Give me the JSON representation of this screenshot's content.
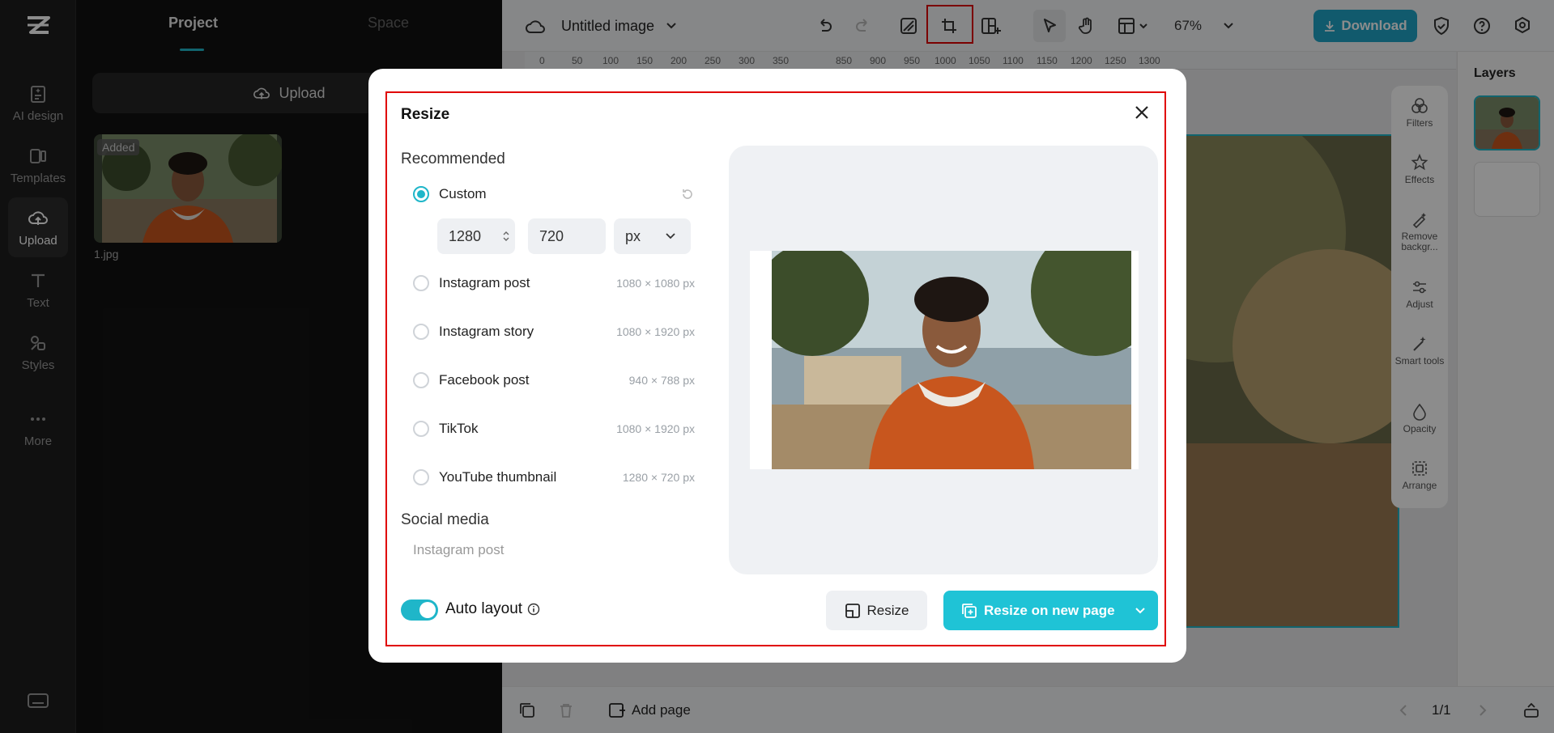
{
  "rail": {
    "items": [
      {
        "label": "AI design",
        "icon": "ai-design-icon"
      },
      {
        "label": "Templates",
        "icon": "templates-icon"
      },
      {
        "label": "Upload",
        "icon": "upload-cloud-icon",
        "active": true
      },
      {
        "label": "Text",
        "icon": "text-icon"
      },
      {
        "label": "Styles",
        "icon": "styles-icon"
      },
      {
        "label": "More",
        "icon": "more-icon"
      }
    ]
  },
  "panel": {
    "tabs": [
      "Project",
      "Space"
    ],
    "upload_label": "Upload",
    "asset": {
      "badge": "Added",
      "name": "1.jpg"
    }
  },
  "topbar": {
    "doc_title": "Untitled image",
    "zoom": "67%",
    "download_label": "Download"
  },
  "ruler": {
    "ticks_left": [
      "0",
      "50",
      "100",
      "150",
      "200",
      "250",
      "300",
      "350"
    ],
    "ticks_right": [
      "850",
      "900",
      "950",
      "1000",
      "1050",
      "1100",
      "1150",
      "1200",
      "1250",
      "1300"
    ]
  },
  "tools": [
    {
      "label": "Filters",
      "icon": "filters-icon"
    },
    {
      "label": "Effects",
      "icon": "effects-icon"
    },
    {
      "label": "Remove backgr...",
      "icon": "remove-background-icon"
    },
    {
      "label": "Adjust",
      "icon": "adjust-icon"
    },
    {
      "label": "Smart tools",
      "icon": "smart-tools-icon"
    },
    {
      "label": "Opacity",
      "icon": "opacity-icon"
    },
    {
      "label": "Arrange",
      "icon": "arrange-icon"
    }
  ],
  "layers": {
    "title": "Layers"
  },
  "bottombar": {
    "add_page": "Add page",
    "pager": "1/1"
  },
  "modal": {
    "title": "Resize",
    "recommended_heading": "Recommended",
    "custom": {
      "label": "Custom",
      "width": "1280",
      "height": "720",
      "unit": "px"
    },
    "options": [
      {
        "label": "Instagram post",
        "dims": "1080 × 1080 px"
      },
      {
        "label": "Instagram story",
        "dims": "1080 × 1920 px"
      },
      {
        "label": "Facebook post",
        "dims": "940 × 788 px"
      },
      {
        "label": "TikTok",
        "dims": "1080 × 1920 px"
      },
      {
        "label": "YouTube thumbnail",
        "dims": "1280 × 720 px"
      }
    ],
    "social_heading": "Social media",
    "social_items": [
      "Instagram post"
    ],
    "auto_layout_label": "Auto layout",
    "auto_layout_on": true,
    "resize_label": "Resize",
    "resize_new_label": "Resize on new page"
  },
  "colors": {
    "accent": "#1fc3d6",
    "highlight": "#e00000",
    "download": "#1fa5c7"
  }
}
